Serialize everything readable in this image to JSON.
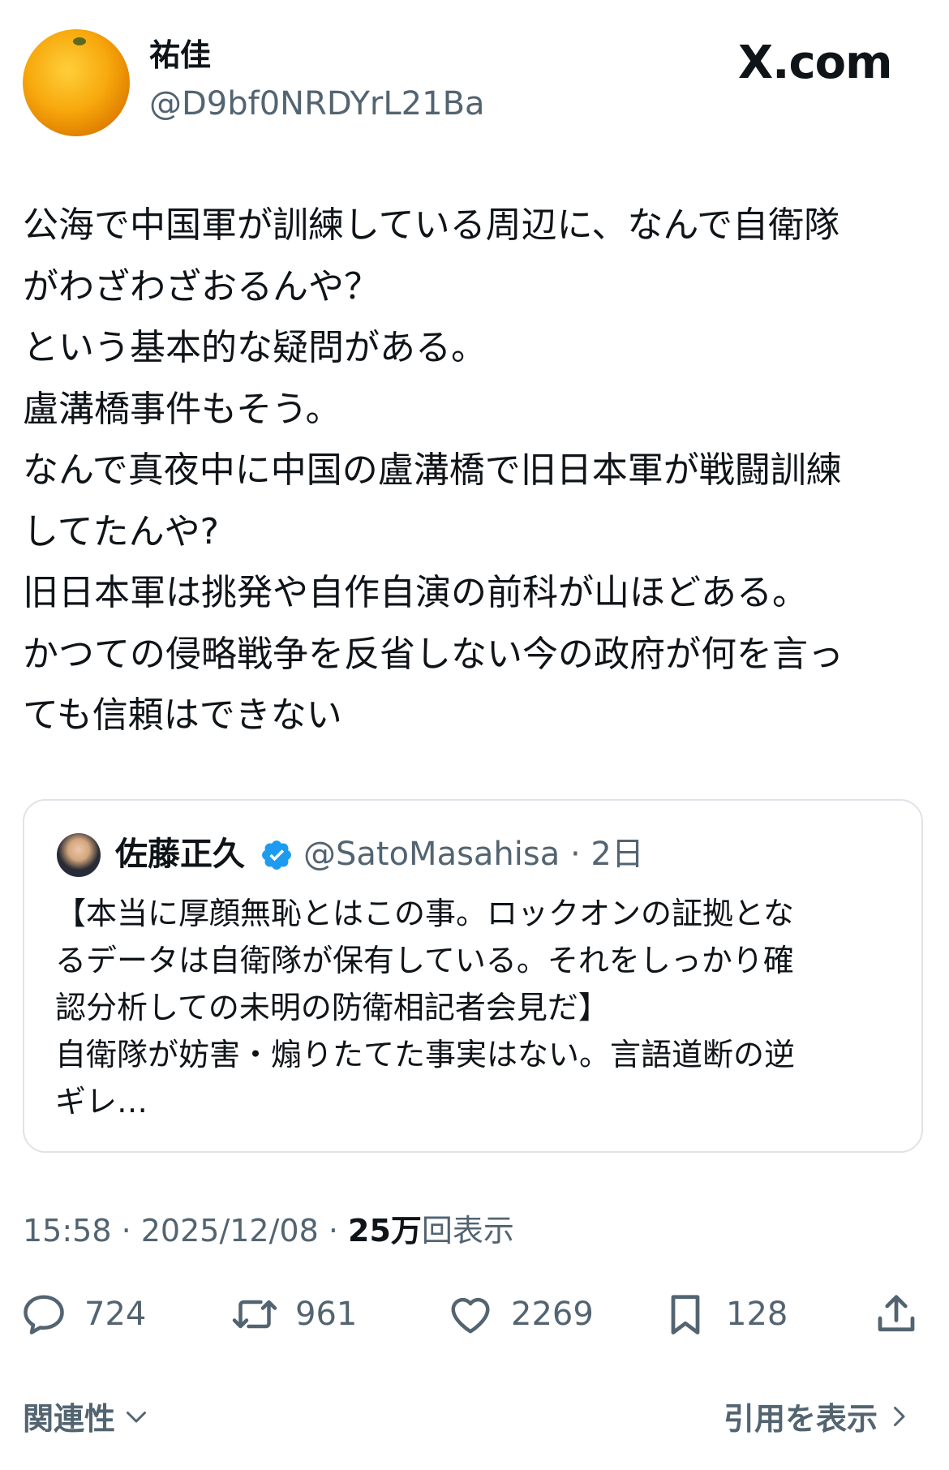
{
  "author": {
    "display_name": "祐佳",
    "handle": "@D9bf0NRDYrL21Ba",
    "avatar_icon": "orange-fruit-avatar"
  },
  "brand": "X.com",
  "tweet": {
    "text": "公海で中国軍が訓練している周辺に、なんで自衛隊\nがわざわざおるんや？\nという基本的な疑問がある。\n盧溝橋事件もそう。\nなんで真夜中に中国の盧溝橋で旧日本軍が戦闘訓練\nしてたんや?\n旧日本軍は挑発や自作自演の前科が山ほどある。\nかつての侵略戦争を反省しない今の政府が何を言っ\nても信頼はできない"
  },
  "quote": {
    "name": "佐藤正久",
    "verified_icon": "verified-badge-icon",
    "verified_color": "#1d9bf0",
    "handle_time": "@SatoMasahisa · 2日",
    "text": "【本当に厚顔無恥とはこの事。ロックオンの証拠とな\nるデータは自衛隊が保有している。それをしっかり確\n認分析しての未明の防衛相記者会見だ】\n自衛隊が妨害・煽りたてた事実はない。言語道断の逆\nギレ…"
  },
  "meta": {
    "time_date": "15:58 · 2025/12/08 · ",
    "views_count": "25万",
    "views_label": "回表示"
  },
  "actions": {
    "reply": {
      "icon": "reply-icon",
      "count": "724"
    },
    "retweet": {
      "icon": "retweet-icon",
      "count": "961"
    },
    "like": {
      "icon": "heart-icon",
      "count": "2269"
    },
    "bookmark": {
      "icon": "bookmark-icon",
      "count": "128"
    },
    "share": {
      "icon": "share-icon"
    }
  },
  "footer": {
    "related_label": "関連性",
    "quotes_label": "引用を表示"
  }
}
